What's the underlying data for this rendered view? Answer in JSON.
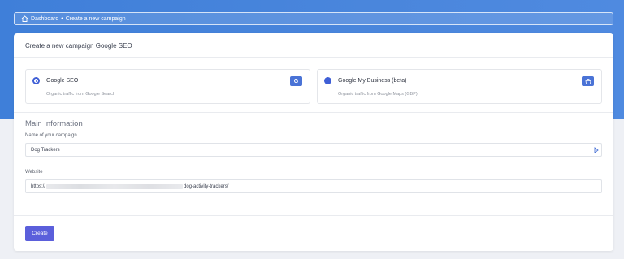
{
  "breadcrumb": {
    "home_icon": "home-icon",
    "root": "Dashboard",
    "separator": "•",
    "current": "Create a new campaign"
  },
  "card": {
    "title": "Create a new campaign Google SEO"
  },
  "options": [
    {
      "title": "Google SEO",
      "subtitle": "Organic traffic from Google Search",
      "selected": true,
      "badge": "G",
      "icon": "google-icon"
    },
    {
      "title": "Google My Business (beta)",
      "subtitle": "Organic traffic from Google Maps (GBP)",
      "selected": false,
      "badge": "",
      "icon": "shop-icon"
    }
  ],
  "main": {
    "section_title": "Main Information",
    "campaign_name_label": "Name of your campaign",
    "campaign_name_value": "Dog Trackers",
    "website_label": "Website",
    "website_prefix": "https://",
    "website_suffix": "dog-activity-trackers/"
  },
  "actions": {
    "create_label": "Create"
  },
  "colors": {
    "accent": "#3f5fd6",
    "button": "#5b5fdb",
    "header": "#4a86dc"
  }
}
